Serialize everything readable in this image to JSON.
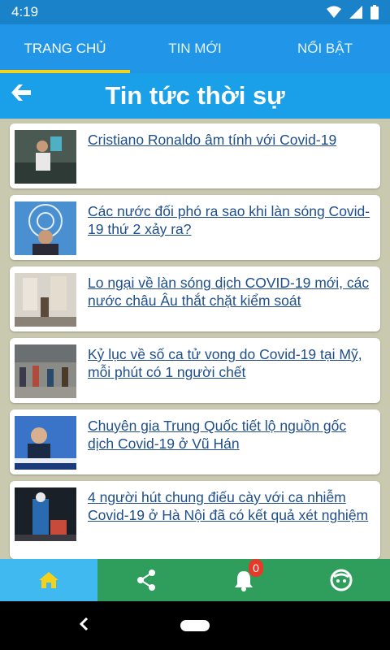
{
  "status": {
    "time": "4:19"
  },
  "tabs": [
    {
      "label": "TRANG CHỦ",
      "active": true
    },
    {
      "label": "TIN MỚI",
      "active": false
    },
    {
      "label": "NỔI BẬT",
      "active": false
    }
  ],
  "header": {
    "title": "Tin tức thời sự"
  },
  "news": [
    {
      "title": "Cristiano Ronaldo âm tính với Covid-19"
    },
    {
      "title": "Các nước đối phó ra sao khi làn sóng Covid-19 thứ 2 xảy ra?"
    },
    {
      "title": "Lo ngại về làn sóng dịch COVID-19 mới, các nước châu Âu thắt chặt kiểm soát"
    },
    {
      "title": "Kỷ lục về số ca tử vong do Covid-19 tại Mỹ, mỗi phút có 1 người chết"
    },
    {
      "title": "Chuyên gia Trung Quốc tiết lộ nguồn gốc dịch Covid-19 ở Vũ Hán"
    },
    {
      "title": "4 người hút chung điếu cày với ca nhiễm Covid-19 ở Hà Nội đã có kết quả xét nghiệm"
    }
  ],
  "bottom_nav": {
    "notification_count": "0",
    "items": [
      "home-icon",
      "share-icon",
      "bell-icon",
      "face-icon"
    ]
  },
  "colors": {
    "status_bar": "#1a82c8",
    "tab_bar": "#2196e8",
    "tab_indicator": "#f5d21a",
    "header": "#1aa0e8",
    "background": "#c9c9b0",
    "bottom_nav": "#2f9e5c",
    "bottom_nav_active": "#3fb9f0",
    "badge": "#e53a2a"
  }
}
